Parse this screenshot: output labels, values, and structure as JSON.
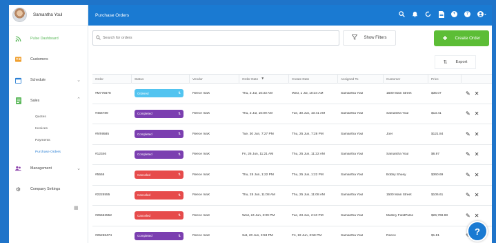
{
  "profile": {
    "name": "Samantha Youl"
  },
  "sidebar": {
    "items": [
      {
        "label": "Pulse Dashboard",
        "icon": "rss-icon",
        "color": "#5bb85a"
      },
      {
        "label": "Customers",
        "icon": "contact-card-icon",
        "color": "#f0a030"
      },
      {
        "label": "Schedule",
        "icon": "calendar-icon",
        "color": "#2a7fd4"
      },
      {
        "label": "Sales",
        "icon": "receipt-icon",
        "color": "#5bb85a"
      },
      {
        "label": "Management",
        "icon": "users-icon",
        "color": "#8e44ad"
      },
      {
        "label": "Company Settings",
        "icon": "gear-icon",
        "color": "#555555"
      }
    ],
    "sales_sub": [
      "Quotes",
      "Invoices",
      "Payments",
      "Purchase Orders"
    ]
  },
  "topbar": {
    "title": "Purchase Orders"
  },
  "toolbar": {
    "search_placeholder": "Search for orders",
    "filters_label": "Show Filters",
    "create_label": "Create Order",
    "export_label": "Export"
  },
  "table": {
    "headers": [
      "Order",
      "Status",
      "Vendor",
      "Order Date",
      "Create Date",
      "Assigned To",
      "Customer",
      "Price"
    ],
    "rows": [
      {
        "order": "#M775678",
        "status": "Ordered",
        "kind": "blue",
        "vendor": "Reece maX",
        "order_date": "Thu, 2 Jul, 10:33 AM",
        "create_date": "Wed, 1 Jul, 10:34 AM",
        "assigned": "Samantha Youl",
        "customer": "1500 Main Street",
        "price": "$36.07"
      },
      {
        "order": "#456789",
        "status": "Completed",
        "kind": "purple",
        "vendor": "Reece maX",
        "order_date": "Thu, 2 Jul, 10:09 AM",
        "create_date": "Tue, 30 Jun, 10:41 AM",
        "assigned": "Samantha Youl",
        "customer": "Samantha Youl",
        "price": "$13.41"
      },
      {
        "order": "#hfh9585",
        "status": "Completed",
        "kind": "purple",
        "vendor": "Reece maX",
        "order_date": "Tue, 30 Jun, 7:27 PM",
        "create_date": "Thu, 25 Jun, 7:28 PM",
        "assigned": "Samantha Youl",
        "customer": "Joel",
        "price": "$121.84"
      },
      {
        "order": "#12346",
        "status": "Completed",
        "kind": "purple",
        "vendor": "Reece maX",
        "order_date": "Fri, 26 Jun, 11:21 AM",
        "create_date": "Thu, 25 Jun, 11:22 AM",
        "assigned": "Samantha Youl",
        "customer": "Samantha Youl",
        "price": "$6.97"
      },
      {
        "order": "#5555",
        "status": "Canceled",
        "kind": "red",
        "vendor": "Reece maX",
        "order_date": "Thu, 25 Jun, 1:22 PM",
        "create_date": "Thu, 25 Jun, 1:22 PM",
        "assigned": "Samantha Youl",
        "customer": "Bobby Shuey",
        "price": "$360.69"
      },
      {
        "order": "#2225555",
        "status": "Canceled",
        "kind": "red",
        "vendor": "Reece maX",
        "order_date": "Thu, 25 Jun, 11:08 AM",
        "create_date": "Thu, 25 Jun, 11:08 AM",
        "assigned": "Samantha Youl",
        "customer": "1500 Main Street",
        "price": "$106.61"
      },
      {
        "order": "#25552552",
        "status": "Canceled",
        "kind": "red",
        "vendor": "Reece maX",
        "order_date": "Wed, 24 Jun, 3:09 PM",
        "create_date": "Tue, 23 Jun, 2:10 PM",
        "assigned": "Samantha Youl",
        "customer": "Mallory FieldPulse",
        "price": "$26,769.98"
      },
      {
        "order": "#25258474",
        "status": "Completed",
        "kind": "purple",
        "vendor": "Reece maX",
        "order_date": "Sat, 20 Jun, 3:58 PM",
        "create_date": "Fri, 19 Jun, 3:58 PM",
        "assigned": "Samantha Youl",
        "customer": "Reece",
        "price": "$1.81"
      }
    ]
  },
  "help": {
    "label": "?"
  }
}
